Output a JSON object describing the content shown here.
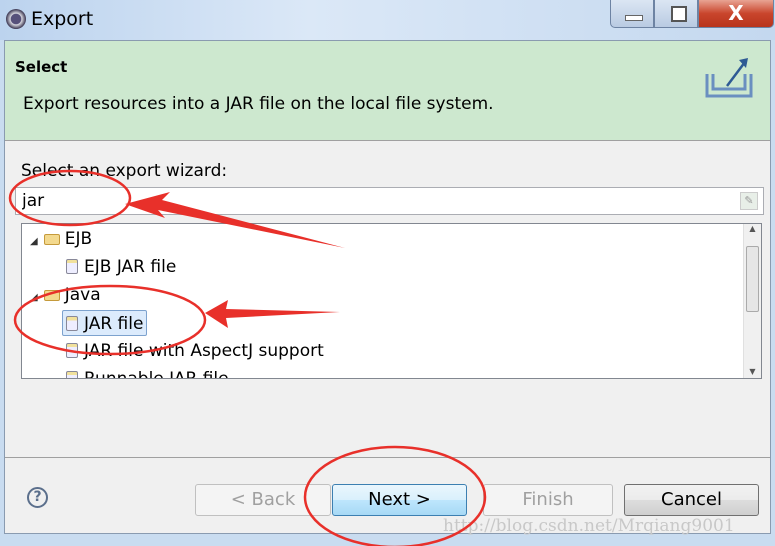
{
  "window": {
    "title": "Export",
    "minimize": "minimize",
    "maximize": "maximize",
    "close": "X"
  },
  "header": {
    "title": "Select",
    "description": "Export resources into a JAR file on the local file system.",
    "icon": "export-icon"
  },
  "wizard": {
    "label": "Select an export wizard:",
    "filter_value": "jar"
  },
  "tree": [
    {
      "label": "EJB",
      "type": "folder",
      "expanded": true
    },
    {
      "label": "EJB JAR file",
      "type": "item"
    },
    {
      "label": "Java",
      "type": "folder",
      "expanded": true
    },
    {
      "label": "JAR file",
      "type": "item",
      "selected": true
    },
    {
      "label": "JAR file with AspectJ support",
      "type": "item"
    },
    {
      "label": "Runnable JAR file",
      "type": "item"
    }
  ],
  "buttons": {
    "back": "< Back",
    "next": "Next >",
    "finish": "Finish",
    "cancel": "Cancel",
    "help": "?"
  },
  "watermark": "http://blog.csdn.net/Mrqiang9001",
  "colors": {
    "header_bg": "#cde8cf",
    "annotation": "#e8302a",
    "selection": "#dcebfc"
  }
}
